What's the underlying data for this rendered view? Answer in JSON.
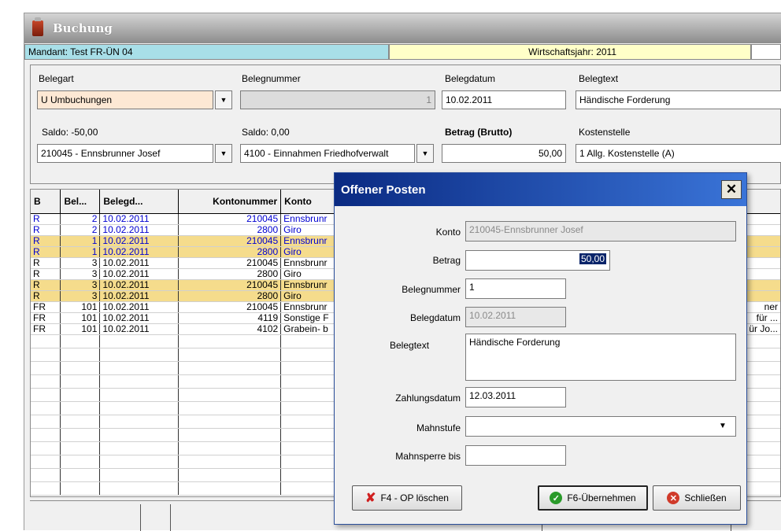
{
  "window": {
    "title": "Buchung"
  },
  "info": {
    "mandant": "Mandant: Test FR-ÜN 04",
    "wirtschaftsjahr": "Wirtschaftsjahr: 2011"
  },
  "form": {
    "belegart_label": "Belegart",
    "belegart_value": "U Umbuchungen",
    "belegnummer_label": "Belegnummer",
    "belegnummer_value": "1",
    "belegdatum_label": "Belegdatum",
    "belegdatum_value": "10.02.2011",
    "belegtext_label": "Belegtext",
    "belegtext_value": "Händische Forderung",
    "saldo1_label": "Saldo: -50,00",
    "konto1_value": "210045 - Ennsbrunner Josef",
    "saldo2_label": "Saldo: 0,00",
    "konto2_value": "4100 - Einnahmen Friedhofverwalt",
    "betrag_label": "Betrag (Brutto)",
    "betrag_value": "50,00",
    "kostenstelle_label": "Kostenstelle",
    "kostenstelle_value": "1 Allg. Kostenstelle (A)"
  },
  "grid": {
    "headers": [
      "B",
      "Bel...",
      "Belegd...",
      "Kontonummer",
      "Konto"
    ],
    "rows": [
      {
        "style": "blue",
        "cells": [
          "R",
          "2",
          "10.02.2011",
          "210045",
          "Ennsbrunr"
        ],
        "extra": ""
      },
      {
        "style": "blue",
        "cells": [
          "R",
          "2",
          "10.02.2011",
          "2800",
          "Giro"
        ],
        "extra": ""
      },
      {
        "style": "yelb",
        "cells": [
          "R",
          "1",
          "10.02.2011",
          "210045",
          "Ennsbrunr"
        ],
        "extra": ""
      },
      {
        "style": "yelb",
        "cells": [
          "R",
          "1",
          "10.02.2011",
          "2800",
          "Giro"
        ],
        "extra": ""
      },
      {
        "style": "plain",
        "cells": [
          "R",
          "3",
          "10.02.2011",
          "210045",
          "Ennsbrunr"
        ],
        "extra": ""
      },
      {
        "style": "plain",
        "cells": [
          "R",
          "3",
          "10.02.2011",
          "2800",
          "Giro"
        ],
        "extra": ""
      },
      {
        "style": "yel",
        "cells": [
          "R",
          "3",
          "10.02.2011",
          "210045",
          "Ennsbrunr"
        ],
        "extra": ""
      },
      {
        "style": "yel",
        "cells": [
          "R",
          "3",
          "10.02.2011",
          "2800",
          "Giro"
        ],
        "extra": ""
      },
      {
        "style": "plain",
        "cells": [
          "FR",
          "101",
          "10.02.2011",
          "210045",
          "Ennsbrunr"
        ],
        "extra": "ner"
      },
      {
        "style": "plain",
        "cells": [
          "FR",
          "101",
          "10.02.2011",
          "4119",
          "Sonstige F"
        ],
        "extra": "für ..."
      },
      {
        "style": "plain",
        "cells": [
          "FR",
          "101",
          "10.02.2011",
          "4102",
          "Grabein- b"
        ],
        "extra": "ür Jo..."
      }
    ]
  },
  "dialog": {
    "title": "Offener Posten",
    "konto_label": "Konto",
    "konto_value": "210045-Ennsbrunner Josef",
    "betrag_label": "Betrag",
    "betrag_value": "50,00",
    "belegnummer_label": "Belegnummer",
    "belegnummer_value": "1",
    "belegdatum_label": "Belegdatum",
    "belegdatum_value": "10.02.2011",
    "belegtext_label": "Belegtext",
    "belegtext_value": "Händische Forderung",
    "zahlungsdatum_label": "Zahlungsdatum",
    "zahlungsdatum_value": "12.03.2011",
    "mahnstufe_label": "Mahnstufe",
    "mahnstufe_value": "",
    "mahnsperre_label": "Mahnsperre bis",
    "mahnsperre_value": "",
    "btn_delete": "F4 - OP löschen",
    "btn_accept": "F6-Übernehmen",
    "btn_close": "Schließen"
  },
  "colors": {
    "dialog_title": "#0a2a82",
    "highlight_row": "#f5dc8c",
    "mandant_bg": "#a8dfe8",
    "wj_bg": "#ffffc8"
  }
}
